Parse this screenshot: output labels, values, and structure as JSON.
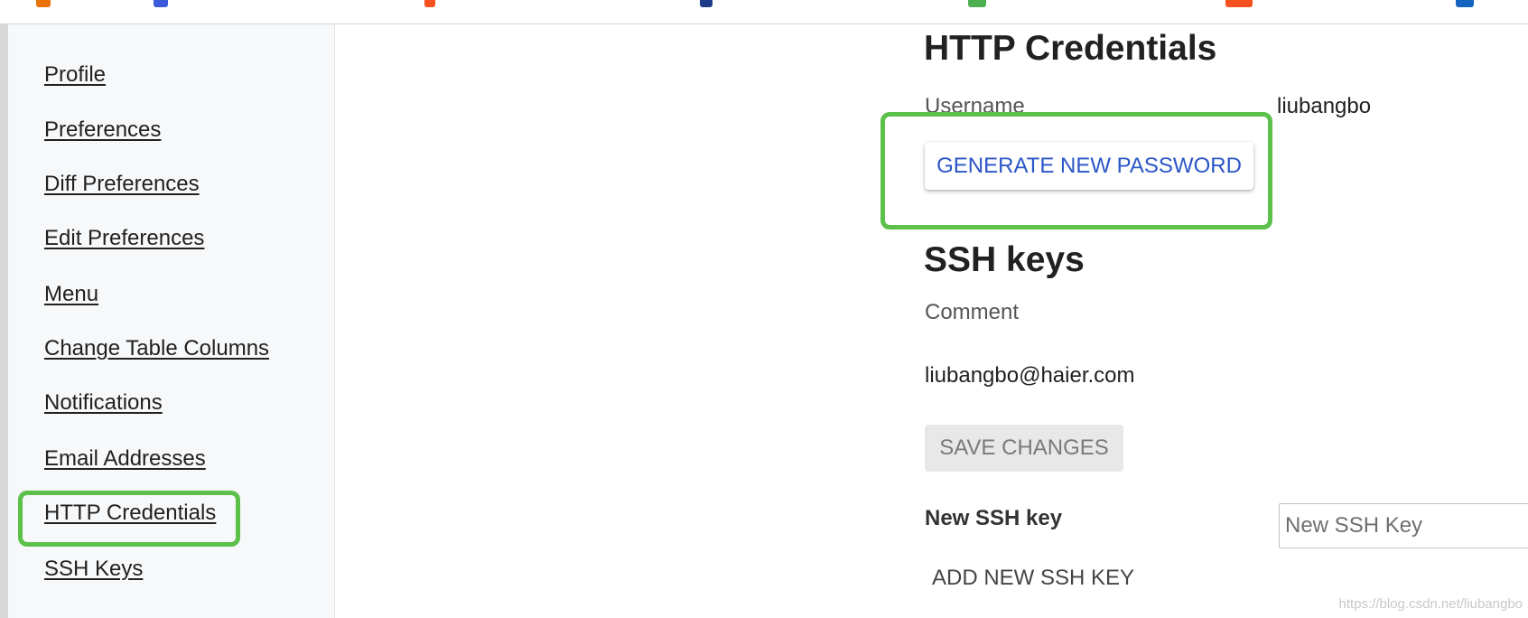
{
  "sidebar": {
    "items": [
      {
        "label": "Profile"
      },
      {
        "label": "Preferences"
      },
      {
        "label": "Diff Preferences"
      },
      {
        "label": "Edit Preferences"
      },
      {
        "label": "Menu"
      },
      {
        "label": "Change Table Columns"
      },
      {
        "label": "Notifications"
      },
      {
        "label": "Email Addresses"
      },
      {
        "label": "HTTP Credentials"
      },
      {
        "label": "SSH Keys"
      }
    ]
  },
  "http_credentials": {
    "title": "HTTP Credentials",
    "username_label": "Username",
    "username_value": "liubangbo",
    "generate_button": "GENERATE NEW PASSWORD"
  },
  "ssh_keys": {
    "title": "SSH keys",
    "comment_label": "Comment",
    "comment_value": "liubangbo@haier.com",
    "save_button": "SAVE CHANGES",
    "new_key_label": "New SSH key",
    "new_key_placeholder": "New SSH Key",
    "add_button": "ADD NEW SSH KEY"
  },
  "watermark": "https://blog.csdn.net/liubangbo",
  "colors": {
    "highlight": "#5cc14a",
    "link_button": "#2a56c6",
    "sidebar_bg": "#f7f8f9"
  }
}
